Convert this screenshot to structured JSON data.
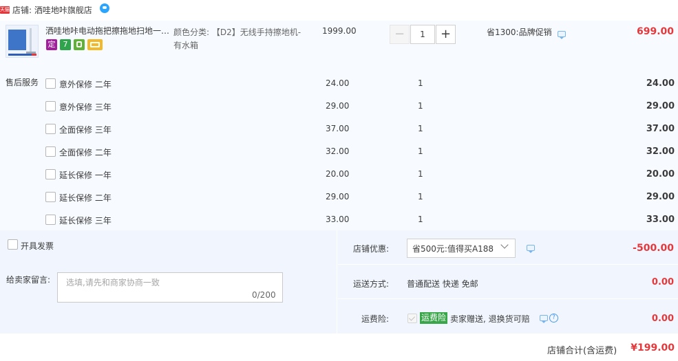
{
  "shop": {
    "badge": "天猫",
    "label": "店铺: 洒哇地咔旗舰店"
  },
  "item": {
    "title": "洒哇地咔电动拖把擦拖地扫地一体机",
    "service_icons": [
      "定",
      "7",
      "plug-icon",
      "card-icon"
    ],
    "sku": "颜色分类: 【D2】无线手持擦地机-有水箱",
    "unit_price": "1999.00",
    "quantity": "1",
    "minus_symbol": "−",
    "plus_symbol": "+",
    "promo": "省1300:品牌促销",
    "total": "699.00"
  },
  "aftersale": {
    "label": "售后服务",
    "rows": [
      {
        "name": "意外保修 二年",
        "price": "24.00",
        "qty": "1",
        "total": "24.00"
      },
      {
        "name": "意外保修 三年",
        "price": "29.00",
        "qty": "1",
        "total": "29.00"
      },
      {
        "name": "全面保修 三年",
        "price": "37.00",
        "qty": "1",
        "total": "37.00"
      },
      {
        "name": "全面保修 二年",
        "price": "32.00",
        "qty": "1",
        "total": "32.00"
      },
      {
        "name": "延长保修 一年",
        "price": "20.00",
        "qty": "1",
        "total": "20.00"
      },
      {
        "name": "延长保修 二年",
        "price": "29.00",
        "qty": "1",
        "total": "29.00"
      },
      {
        "name": "延长保修 三年",
        "price": "33.00",
        "qty": "1",
        "total": "33.00"
      }
    ]
  },
  "invoice": {
    "label": "开具发票"
  },
  "message": {
    "label": "给卖家留言:",
    "placeholder": "选填,请先和商家协商一致",
    "count": "0/200"
  },
  "discount": {
    "label": "店铺优惠:",
    "selected": "省500元:值得买A188",
    "amount": "-500.00"
  },
  "shipping": {
    "label": "运送方式:",
    "method": "普通配送 快递 免邮",
    "amount": "0.00"
  },
  "insurance": {
    "label": "运费险:",
    "badge": "运费险",
    "desc": "卖家赠送, 退换货可赔",
    "help": "?",
    "amount": "0.00"
  },
  "footer": {
    "label": "店铺合计(含运费)",
    "total": "¥199.00"
  },
  "colors": {
    "price_red": "#e4393c",
    "panel_bg": "#f1f6fe",
    "item_bg": "#f7fafe",
    "insurance_green": "#3aa64a"
  }
}
